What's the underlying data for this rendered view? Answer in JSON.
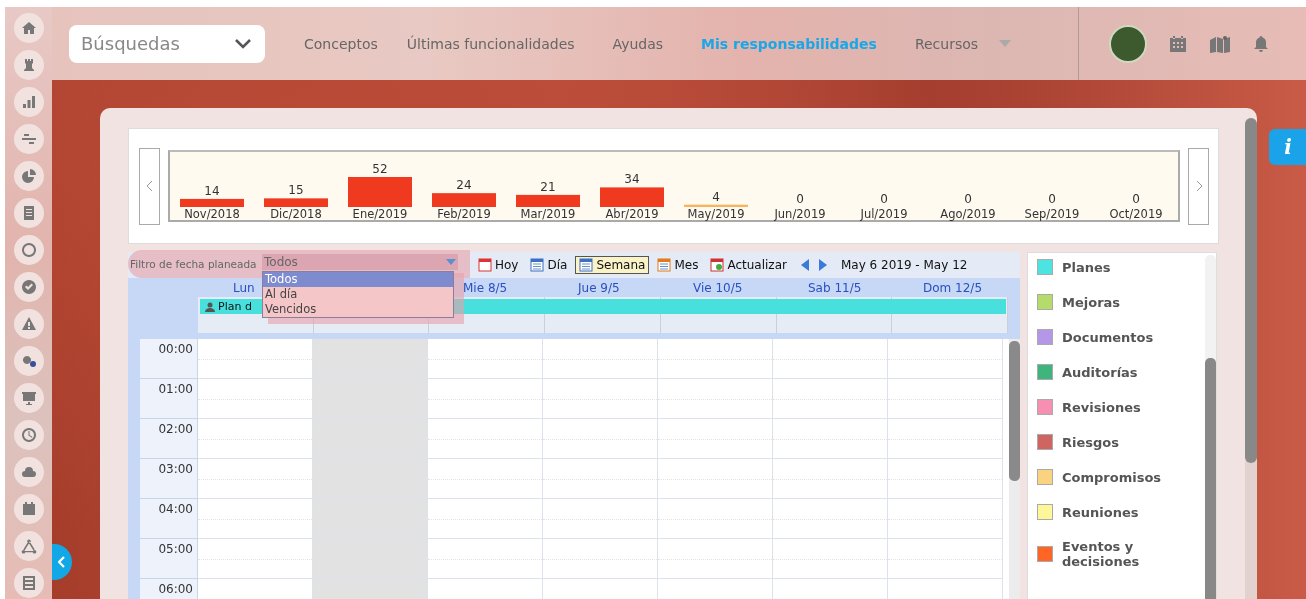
{
  "search": {
    "value": "Búsquedas"
  },
  "nav": [
    {
      "label": "Conceptos",
      "selected": false,
      "has_menu": false
    },
    {
      "label": "Últimas funcionalidades",
      "selected": false,
      "has_menu": false
    },
    {
      "label": "Ayudas",
      "selected": false,
      "has_menu": false
    },
    {
      "label": "Mis responsabilidades",
      "selected": true,
      "has_menu": false
    },
    {
      "label": "Recursos",
      "selected": false,
      "has_menu": true
    }
  ],
  "info_button": "i",
  "chart": {
    "chart_data": {
      "type": "bar",
      "categories": [
        "Nov/2018",
        "Dic/2018",
        "Ene/2019",
        "Feb/2019",
        "Mar/2019",
        "Abr/2019",
        "May/2019",
        "Jun/2019",
        "Jul/2019",
        "Ago/2019",
        "Sep/2019",
        "Oct/2019"
      ],
      "stacked": true,
      "data_labels": true,
      "series": [
        {
          "color": "#f03a20",
          "values": [
            14,
            15,
            52,
            24,
            21,
            34,
            null,
            0,
            0,
            0,
            0,
            0
          ]
        },
        {
          "color": "#f7b45c",
          "values": [
            null,
            null,
            null,
            null,
            null,
            null,
            4,
            null,
            null,
            null,
            null,
            null
          ]
        }
      ]
    }
  },
  "filter": {
    "label": "Filtro de fecha planeada",
    "value": "Todos",
    "expanded": true,
    "options": [
      {
        "label": "Todos",
        "selected": true
      },
      {
        "label": "Al día",
        "selected": false
      },
      {
        "label": "Vencidos",
        "selected": false
      }
    ]
  },
  "views": [
    {
      "label": "Hoy",
      "kind": "today",
      "selected": false
    },
    {
      "label": "Día",
      "kind": "day",
      "selected": false
    },
    {
      "label": "Semana",
      "kind": "week",
      "selected": true
    },
    {
      "label": "Mes",
      "kind": "month",
      "selected": false
    },
    {
      "label": "Actualizar",
      "kind": "refresh",
      "selected": false
    }
  ],
  "range": "May 6 2019 - May 12",
  "days": [
    {
      "label": "Lun",
      "shaded": false
    },
    {
      "shaded": true
    },
    {
      "label": "Mie 8/5",
      "shaded": false
    },
    {
      "label": "Jue 9/5",
      "shaded": false
    },
    {
      "label": "Vie 10/5",
      "shaded": false
    },
    {
      "label": "Sab 11/5",
      "shaded": false
    },
    {
      "label": "Dom 12/5",
      "shaded": false
    }
  ],
  "events": [
    {
      "label": "Plan d",
      "color": "#48e0dc"
    }
  ],
  "hours": [
    "00:00",
    "01:00",
    "02:00",
    "03:00",
    "04:00",
    "05:00",
    "06:00"
  ],
  "legend": [
    {
      "label": "Planes",
      "color": "#4de3e0"
    },
    {
      "label": "Mejoras",
      "color": "#b5dc6a"
    },
    {
      "label": "Documentos",
      "color": "#b497e6"
    },
    {
      "label": "Auditorías",
      "color": "#3eb57c"
    },
    {
      "label": "Revisiones",
      "color": "#f78fb2"
    },
    {
      "label": "Riesgos",
      "color": "#cf6560"
    },
    {
      "label": "Compromisos",
      "color": "#f9d37f"
    },
    {
      "label": "Reuniones",
      "color": "#fdf79a"
    },
    {
      "label": "Eventos y decisiones",
      "color": "#ff6524"
    }
  ]
}
